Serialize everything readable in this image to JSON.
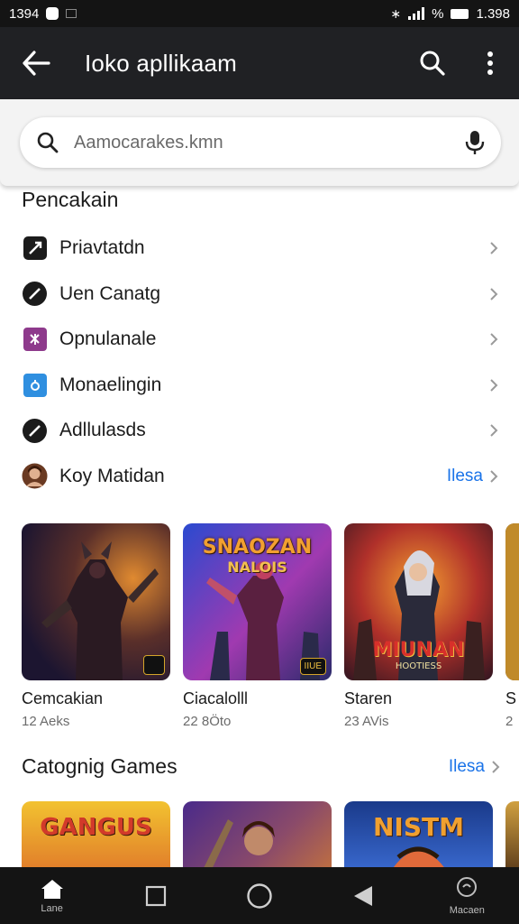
{
  "status_bar": {
    "time": "1394",
    "battery": "1.398"
  },
  "app_bar": {
    "title": "Ioko apllikaam"
  },
  "search": {
    "placeholder": "Aamocarakes.kmn"
  },
  "section1": {
    "title": "Pencakain"
  },
  "list_items": [
    {
      "label": "Priavtatdn",
      "icon": "slash-icon",
      "icon_bg": "#1b1b1b",
      "more": ""
    },
    {
      "label": "Uen Canatg",
      "icon": "slash-circle-icon",
      "icon_bg": "#1b1b1b",
      "more": ""
    },
    {
      "label": "Opnulanale",
      "icon": "puzzle-icon",
      "icon_bg": "#8e3a8c",
      "more": ""
    },
    {
      "label": "Monaelingin",
      "icon": "link-icon",
      "icon_bg": "#2f8fe0",
      "more": ""
    },
    {
      "label": "Adllulasds",
      "icon": "slash-circle-icon",
      "icon_bg": "#1b1b1b",
      "more": ""
    },
    {
      "label": "Koy Matidan",
      "icon": "avatar-icon",
      "icon_bg": "#a06a3a",
      "more": "Ilesa"
    }
  ],
  "cards": [
    {
      "title": "Cemcakian",
      "sub": "12 Aeks",
      "theme": [
        "#241a3a",
        "#6a3f22",
        "#d27a25"
      ]
    },
    {
      "title": "Ciacalolll",
      "sub": "22 8Öto",
      "theme": [
        "#3a2a8a",
        "#b03aa0",
        "#2a6ad0"
      ]
    },
    {
      "title": "Staren",
      "sub": "23 AVis",
      "theme": [
        "#3a1a2a",
        "#c04a30",
        "#f0a030"
      ]
    },
    {
      "title": "S",
      "sub": "2",
      "theme": [
        "#3a2a1a",
        "#a06020",
        "#e0b040"
      ]
    }
  ],
  "thumb_texts": {
    "card2_line1": "SNAOZAN",
    "card2_line2": "NALOIS",
    "card3_line1": "MIUNAN",
    "card3_line2": "HOOTIESS",
    "card2_badge": "IIUE"
  },
  "section2": {
    "title": "Catognig Games",
    "more": "Ilesa"
  },
  "bottom_cards": [
    {
      "text": "GANGUS",
      "theme": [
        "#f2c230",
        "#d23a2a"
      ]
    },
    {
      "text": "",
      "theme": [
        "#4a2a8a",
        "#c07040"
      ]
    },
    {
      "text": "NISTM",
      "theme": [
        "#1a3a8a",
        "#e06a3a"
      ]
    },
    {
      "text": "",
      "theme": [
        "#5a3a1a",
        "#d0a040"
      ]
    }
  ],
  "nav": {
    "home_label": "Lane",
    "search_label": "Macaen"
  }
}
